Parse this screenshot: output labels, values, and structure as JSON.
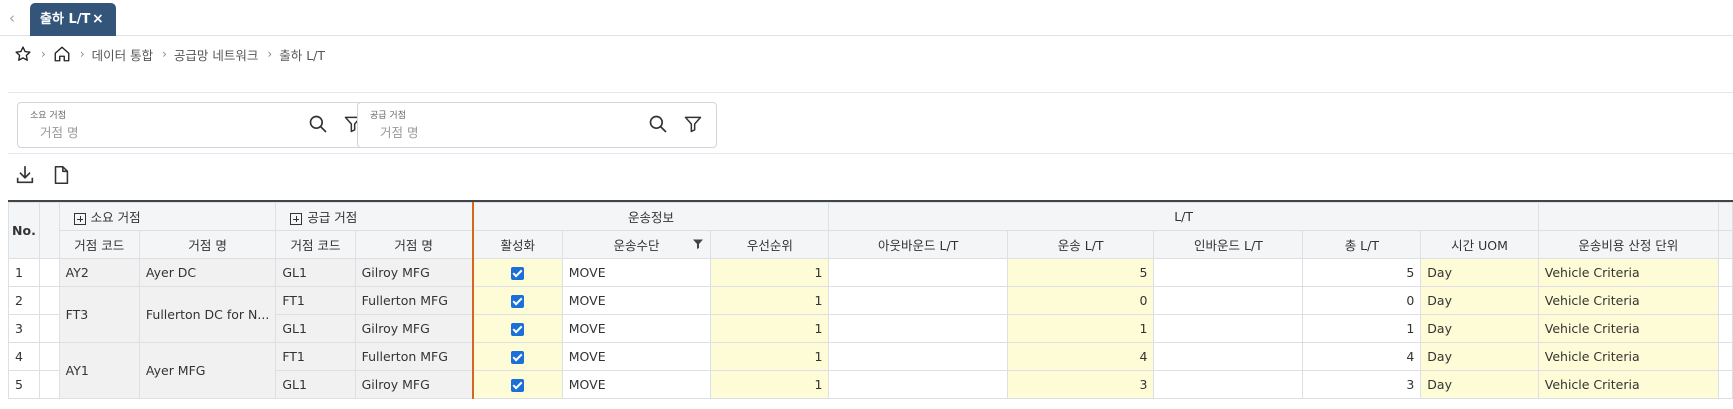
{
  "tabs": {
    "active_label": "출하 L/T",
    "close_glyph": "×",
    "prev_glyph": "‹"
  },
  "breadcrumb": {
    "items": [
      "데이터 통합",
      "공급망 네트워크",
      "출하 L/T"
    ],
    "sep": "›"
  },
  "filters": [
    {
      "label": "소요 거점",
      "placeholder": "거점 명"
    },
    {
      "label": "공급 거점",
      "placeholder": "거점 명"
    }
  ],
  "icons": {
    "star": "star-icon",
    "home": "home-icon",
    "search": "search-icon",
    "filter": "filter-icon",
    "download": "download-icon",
    "file": "file-icon"
  },
  "grid": {
    "header": {
      "no": "No.",
      "demand_group": "소요 거점",
      "supply_group": "공급 거점",
      "transport_group": "운송정보",
      "lt_group": "L/T",
      "cols": [
        "거점 코드",
        "거점 명",
        "거점 코드",
        "거점 명",
        "활성화",
        "운송수단",
        "우선순위",
        "아웃바운드 L/T",
        "운송 L/T",
        "인바운드 L/T",
        "총 L/T",
        "시간 UOM",
        "운송비용 산정 단위"
      ]
    },
    "rows": [
      {
        "no": "1",
        "dcode": "AY2",
        "dname": "Ayer DC",
        "scode": "GL1",
        "sname": "Gilroy MFG",
        "active": true,
        "mode": "MOVE",
        "priority": "1",
        "outbound": "",
        "transport": "5",
        "inbound": "",
        "total": "5",
        "uom": "Day",
        "cost_unit": "Vehicle Criteria"
      },
      {
        "no": "2",
        "dcode": "FT3",
        "dname": "Fullerton DC for N...",
        "scode": "FT1",
        "sname": "Fullerton MFG",
        "active": true,
        "mode": "MOVE",
        "priority": "1",
        "outbound": "",
        "transport": "0",
        "inbound": "",
        "total": "0",
        "uom": "Day",
        "cost_unit": "Vehicle Criteria"
      },
      {
        "no": "3",
        "dcode": "",
        "dname": "",
        "scode": "GL1",
        "sname": "Gilroy MFG",
        "active": true,
        "mode": "MOVE",
        "priority": "1",
        "outbound": "",
        "transport": "1",
        "inbound": "",
        "total": "1",
        "uom": "Day",
        "cost_unit": "Vehicle Criteria"
      },
      {
        "no": "4",
        "dcode": "AY1",
        "dname": "Ayer MFG",
        "scode": "FT1",
        "sname": "Fullerton MFG",
        "active": true,
        "mode": "MOVE",
        "priority": "1",
        "outbound": "",
        "transport": "4",
        "inbound": "",
        "total": "4",
        "uom": "Day",
        "cost_unit": "Vehicle Criteria"
      },
      {
        "no": "5",
        "dcode": "",
        "dname": "",
        "scode": "GL1",
        "sname": "Gilroy MFG",
        "active": true,
        "mode": "MOVE",
        "priority": "1",
        "outbound": "",
        "transport": "3",
        "inbound": "",
        "total": "3",
        "uom": "Day",
        "cost_unit": "Vehicle Criteria"
      }
    ]
  },
  "colors": {
    "tab_active": "#33557a",
    "checkbox": "#1a6fd8",
    "frozen_divider": "#d2691e",
    "editable_cell": "#fdfcd6"
  }
}
